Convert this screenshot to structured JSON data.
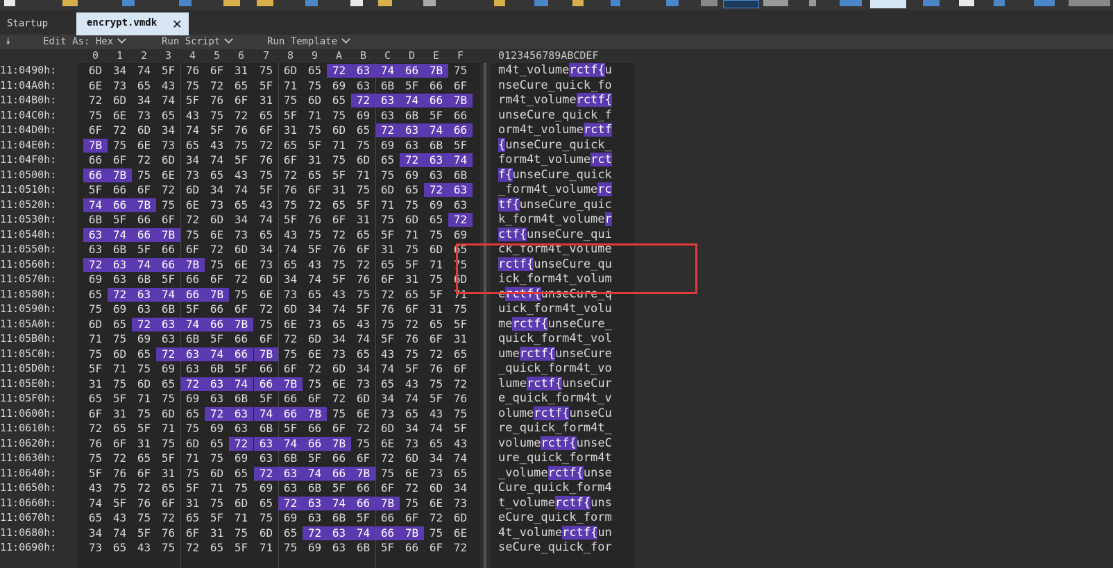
{
  "tabs": {
    "startup": "Startup",
    "active": "encrypt.vmdk"
  },
  "subbar": {
    "edit_as": "Edit As: Hex",
    "run_script": "Run Script",
    "run_template": "Run Template"
  },
  "hex_columns": [
    "0",
    "1",
    "2",
    "3",
    "4",
    "5",
    "6",
    "7",
    "8",
    "9",
    "A",
    "B",
    "C",
    "D",
    "E",
    "F"
  ],
  "char_header": "0123456789ABCDEF",
  "highlight_color": "#5b3ab0",
  "rows": [
    {
      "addr": "11:0490h:",
      "bytes": [
        "6D",
        "34",
        "74",
        "5F",
        "76",
        "6F",
        "31",
        "75",
        "6D",
        "65",
        "72",
        "63",
        "74",
        "66",
        "7B",
        "75"
      ],
      "hl": [
        10,
        11,
        12,
        13,
        14
      ],
      "chars": "m4t_volumerctf{u"
    },
    {
      "addr": "11:04A0h:",
      "bytes": [
        "6E",
        "73",
        "65",
        "43",
        "75",
        "72",
        "65",
        "5F",
        "71",
        "75",
        "69",
        "63",
        "6B",
        "5F",
        "66",
        "6F"
      ],
      "hl": [],
      "chars": "nseCure_quick_fo"
    },
    {
      "addr": "11:04B0h:",
      "bytes": [
        "72",
        "6D",
        "34",
        "74",
        "5F",
        "76",
        "6F",
        "31",
        "75",
        "6D",
        "65",
        "72",
        "63",
        "74",
        "66",
        "7B"
      ],
      "hl": [
        11,
        12,
        13,
        14,
        15
      ],
      "chars": "rm4t_volumerctf{"
    },
    {
      "addr": "11:04C0h:",
      "bytes": [
        "75",
        "6E",
        "73",
        "65",
        "43",
        "75",
        "72",
        "65",
        "5F",
        "71",
        "75",
        "69",
        "63",
        "6B",
        "5F",
        "66"
      ],
      "hl": [],
      "chars": "unseCure_quick_f"
    },
    {
      "addr": "11:04D0h:",
      "bytes": [
        "6F",
        "72",
        "6D",
        "34",
        "74",
        "5F",
        "76",
        "6F",
        "31",
        "75",
        "6D",
        "65",
        "72",
        "63",
        "74",
        "66"
      ],
      "hl": [
        12,
        13,
        14,
        15
      ],
      "chars": "orm4t_volumerctf"
    },
    {
      "addr": "11:04E0h:",
      "bytes": [
        "7B",
        "75",
        "6E",
        "73",
        "65",
        "43",
        "75",
        "72",
        "65",
        "5F",
        "71",
        "75",
        "69",
        "63",
        "6B",
        "5F"
      ],
      "hl": [
        0
      ],
      "chars": "{unseCure_quick_"
    },
    {
      "addr": "11:04F0h:",
      "bytes": [
        "66",
        "6F",
        "72",
        "6D",
        "34",
        "74",
        "5F",
        "76",
        "6F",
        "31",
        "75",
        "6D",
        "65",
        "72",
        "63",
        "74"
      ],
      "hl": [
        13,
        14,
        15
      ],
      "chars": "form4t_volumerct"
    },
    {
      "addr": "11:0500h:",
      "bytes": [
        "66",
        "7B",
        "75",
        "6E",
        "73",
        "65",
        "43",
        "75",
        "72",
        "65",
        "5F",
        "71",
        "75",
        "69",
        "63",
        "6B"
      ],
      "hl": [
        0,
        1
      ],
      "chars": "f{unseCure_quick"
    },
    {
      "addr": "11:0510h:",
      "bytes": [
        "5F",
        "66",
        "6F",
        "72",
        "6D",
        "34",
        "74",
        "5F",
        "76",
        "6F",
        "31",
        "75",
        "6D",
        "65",
        "72",
        "63"
      ],
      "hl": [
        14,
        15
      ],
      "chars": "_form4t_volumerc"
    },
    {
      "addr": "11:0520h:",
      "bytes": [
        "74",
        "66",
        "7B",
        "75",
        "6E",
        "73",
        "65",
        "43",
        "75",
        "72",
        "65",
        "5F",
        "71",
        "75",
        "69",
        "63"
      ],
      "hl": [
        0,
        1,
        2
      ],
      "chars": "tf{unseCure_quic"
    },
    {
      "addr": "11:0530h:",
      "bytes": [
        "6B",
        "5F",
        "66",
        "6F",
        "72",
        "6D",
        "34",
        "74",
        "5F",
        "76",
        "6F",
        "31",
        "75",
        "6D",
        "65",
        "72"
      ],
      "hl": [
        15
      ],
      "chars": "k_form4t_volumer"
    },
    {
      "addr": "11:0540h:",
      "bytes": [
        "63",
        "74",
        "66",
        "7B",
        "75",
        "6E",
        "73",
        "65",
        "43",
        "75",
        "72",
        "65",
        "5F",
        "71",
        "75",
        "69"
      ],
      "hl": [
        0,
        1,
        2,
        3
      ],
      "chars": "ctf{unseCure_qui"
    },
    {
      "addr": "11:0550h:",
      "bytes": [
        "63",
        "6B",
        "5F",
        "66",
        "6F",
        "72",
        "6D",
        "34",
        "74",
        "5F",
        "76",
        "6F",
        "31",
        "75",
        "6D",
        "65"
      ],
      "hl": [],
      "chars": "ck_form4t_volume"
    },
    {
      "addr": "11:0560h:",
      "bytes": [
        "72",
        "63",
        "74",
        "66",
        "7B",
        "75",
        "6E",
        "73",
        "65",
        "43",
        "75",
        "72",
        "65",
        "5F",
        "71",
        "75"
      ],
      "hl": [
        0,
        1,
        2,
        3,
        4
      ],
      "chars": "rctf{unseCure_qu"
    },
    {
      "addr": "11:0570h:",
      "bytes": [
        "69",
        "63",
        "6B",
        "5F",
        "66",
        "6F",
        "72",
        "6D",
        "34",
        "74",
        "5F",
        "76",
        "6F",
        "31",
        "75",
        "6D"
      ],
      "hl": [],
      "chars": "ick_form4t_volum"
    },
    {
      "addr": "11:0580h:",
      "bytes": [
        "65",
        "72",
        "63",
        "74",
        "66",
        "7B",
        "75",
        "6E",
        "73",
        "65",
        "43",
        "75",
        "72",
        "65",
        "5F",
        "71"
      ],
      "hl": [
        1,
        2,
        3,
        4,
        5
      ],
      "chars": "erctf{unseCure_q"
    },
    {
      "addr": "11:0590h:",
      "bytes": [
        "75",
        "69",
        "63",
        "6B",
        "5F",
        "66",
        "6F",
        "72",
        "6D",
        "34",
        "74",
        "5F",
        "76",
        "6F",
        "31",
        "75"
      ],
      "hl": [],
      "chars": "uick_form4t_volu"
    },
    {
      "addr": "11:05A0h:",
      "bytes": [
        "6D",
        "65",
        "72",
        "63",
        "74",
        "66",
        "7B",
        "75",
        "6E",
        "73",
        "65",
        "43",
        "75",
        "72",
        "65",
        "5F"
      ],
      "hl": [
        2,
        3,
        4,
        5,
        6
      ],
      "chars": "merctf{unseCure_"
    },
    {
      "addr": "11:05B0h:",
      "bytes": [
        "71",
        "75",
        "69",
        "63",
        "6B",
        "5F",
        "66",
        "6F",
        "72",
        "6D",
        "34",
        "74",
        "5F",
        "76",
        "6F",
        "31"
      ],
      "hl": [],
      "chars": "quick_form4t_vol"
    },
    {
      "addr": "11:05C0h:",
      "bytes": [
        "75",
        "6D",
        "65",
        "72",
        "63",
        "74",
        "66",
        "7B",
        "75",
        "6E",
        "73",
        "65",
        "43",
        "75",
        "72",
        "65"
      ],
      "hl": [
        3,
        4,
        5,
        6,
        7
      ],
      "chars": "umerctf{unseCure"
    },
    {
      "addr": "11:05D0h:",
      "bytes": [
        "5F",
        "71",
        "75",
        "69",
        "63",
        "6B",
        "5F",
        "66",
        "6F",
        "72",
        "6D",
        "34",
        "74",
        "5F",
        "76",
        "6F"
      ],
      "hl": [],
      "chars": "_quick_form4t_vo"
    },
    {
      "addr": "11:05E0h:",
      "bytes": [
        "31",
        "75",
        "6D",
        "65",
        "72",
        "63",
        "74",
        "66",
        "7B",
        "75",
        "6E",
        "73",
        "65",
        "43",
        "75",
        "72"
      ],
      "hl": [
        4,
        5,
        6,
        7,
        8
      ],
      "chars": "lumerctf{unseCur"
    },
    {
      "addr": "11:05F0h:",
      "bytes": [
        "65",
        "5F",
        "71",
        "75",
        "69",
        "63",
        "6B",
        "5F",
        "66",
        "6F",
        "72",
        "6D",
        "34",
        "74",
        "5F",
        "76"
      ],
      "hl": [],
      "chars": "e_quick_form4t_v"
    },
    {
      "addr": "11:0600h:",
      "bytes": [
        "6F",
        "31",
        "75",
        "6D",
        "65",
        "72",
        "63",
        "74",
        "66",
        "7B",
        "75",
        "6E",
        "73",
        "65",
        "43",
        "75"
      ],
      "hl": [
        5,
        6,
        7,
        8,
        9
      ],
      "chars": "olumerctf{unseCu"
    },
    {
      "addr": "11:0610h:",
      "bytes": [
        "72",
        "65",
        "5F",
        "71",
        "75",
        "69",
        "63",
        "6B",
        "5F",
        "66",
        "6F",
        "72",
        "6D",
        "34",
        "74",
        "5F"
      ],
      "hl": [],
      "chars": "re_quick_form4t_"
    },
    {
      "addr": "11:0620h:",
      "bytes": [
        "76",
        "6F",
        "31",
        "75",
        "6D",
        "65",
        "72",
        "63",
        "74",
        "66",
        "7B",
        "75",
        "6E",
        "73",
        "65",
        "43"
      ],
      "hl": [
        6,
        7,
        8,
        9,
        10
      ],
      "chars": "volumerctf{unseC"
    },
    {
      "addr": "11:0630h:",
      "bytes": [
        "75",
        "72",
        "65",
        "5F",
        "71",
        "75",
        "69",
        "63",
        "6B",
        "5F",
        "66",
        "6F",
        "72",
        "6D",
        "34",
        "74"
      ],
      "hl": [],
      "chars": "ure_quick_form4t"
    },
    {
      "addr": "11:0640h:",
      "bytes": [
        "5F",
        "76",
        "6F",
        "31",
        "75",
        "6D",
        "65",
        "72",
        "63",
        "74",
        "66",
        "7B",
        "75",
        "6E",
        "73",
        "65"
      ],
      "hl": [
        7,
        8,
        9,
        10,
        11
      ],
      "chars": "_volumerctf{unse"
    },
    {
      "addr": "11:0650h:",
      "bytes": [
        "43",
        "75",
        "72",
        "65",
        "5F",
        "71",
        "75",
        "69",
        "63",
        "6B",
        "5F",
        "66",
        "6F",
        "72",
        "6D",
        "34"
      ],
      "hl": [],
      "chars": "Cure_quick_form4"
    },
    {
      "addr": "11:0660h:",
      "bytes": [
        "74",
        "5F",
        "76",
        "6F",
        "31",
        "75",
        "6D",
        "65",
        "72",
        "63",
        "74",
        "66",
        "7B",
        "75",
        "6E",
        "73"
      ],
      "hl": [
        8,
        9,
        10,
        11,
        12
      ],
      "chars": "t_volumerctf{uns"
    },
    {
      "addr": "11:0670h:",
      "bytes": [
        "65",
        "43",
        "75",
        "72",
        "65",
        "5F",
        "71",
        "75",
        "69",
        "63",
        "6B",
        "5F",
        "66",
        "6F",
        "72",
        "6D"
      ],
      "hl": [],
      "chars": "eCure_quick_form"
    },
    {
      "addr": "11:0680h:",
      "bytes": [
        "34",
        "74",
        "5F",
        "76",
        "6F",
        "31",
        "75",
        "6D",
        "65",
        "72",
        "63",
        "74",
        "66",
        "7B",
        "75",
        "6E"
      ],
      "hl": [
        9,
        10,
        11,
        12,
        13
      ],
      "chars": "4t_volumerctf{un"
    },
    {
      "addr": "11:0690h:",
      "bytes": [
        "73",
        "65",
        "43",
        "75",
        "72",
        "65",
        "5F",
        "71",
        "75",
        "69",
        "63",
        "6B",
        "5F",
        "66",
        "6F",
        "72"
      ],
      "hl": [],
      "chars": "seCure_quick_for"
    }
  ]
}
